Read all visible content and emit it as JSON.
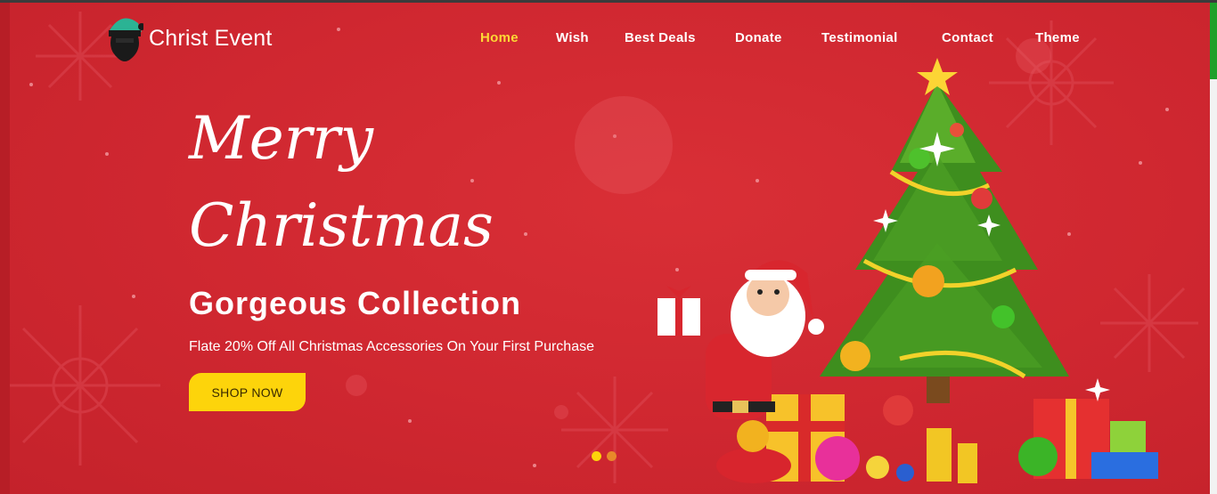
{
  "brand": {
    "name": "Christ Event",
    "logo_icon": "santa-icon"
  },
  "nav": {
    "items": [
      {
        "label": "Home",
        "active": true
      },
      {
        "label": "Wish",
        "active": false
      },
      {
        "label": "Best Deals",
        "active": false
      },
      {
        "label": "Donate",
        "active": false
      },
      {
        "label": "Testimonial",
        "active": false
      },
      {
        "label": "Contact",
        "active": false
      },
      {
        "label": "Theme",
        "active": false
      }
    ]
  },
  "hero": {
    "title_line1": "Merry",
    "title_line2": "Christmas",
    "headline": "Gorgeous Collection",
    "offer": "Flate 20% Off All Christmas Accessories On Your First Purchase",
    "cta_label": "SHOP NOW",
    "illustration": "christmas-tree-santa-gifts"
  },
  "slider": {
    "count": 2,
    "active": 1
  },
  "colors": {
    "background": "#d0282f",
    "accent": "#fdd40b",
    "nav_active": "#fdd835",
    "dot_active": "#fdd40b",
    "dot_inactive": "#e8892a"
  }
}
